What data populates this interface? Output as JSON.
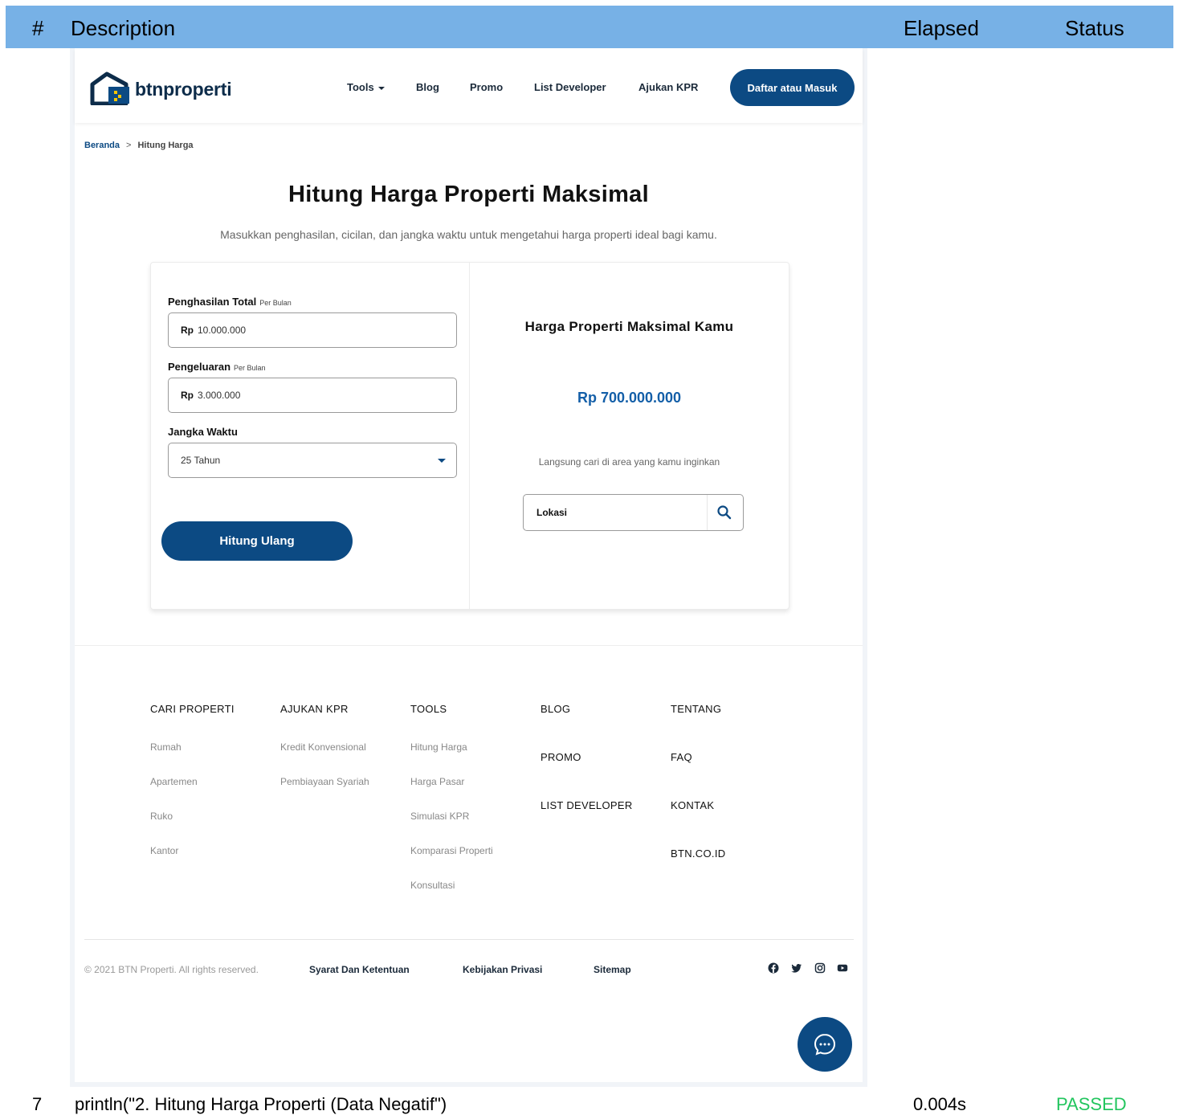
{
  "report": {
    "col_num": "#",
    "col_description": "Description",
    "col_elapsed": "Elapsed",
    "col_status": "Status",
    "row": {
      "num": "7",
      "description": "println(\"2. Hitung Harga Properti (Data Negatif\")",
      "elapsed": "0.004s",
      "status": "PASSED",
      "status_color": "#22c55e"
    }
  },
  "navbar": {
    "brand": "btnproperti",
    "items": [
      "Tools",
      "Blog",
      "Promo",
      "List Developer",
      "Ajukan KPR"
    ],
    "login_label": "Daftar atau Masuk",
    "accent": "#0c4a83"
  },
  "breadcrumb": {
    "home": "Beranda",
    "separator": ">",
    "current": "Hitung Harga"
  },
  "main": {
    "title": "Hitung Harga Properti Maksimal",
    "subtitle": "Masukkan penghasilan, cicilan, dan jangka waktu untuk mengetahui harga properti ideal bagi kamu."
  },
  "form": {
    "income_label": "Penghasilan Total",
    "income_unit": "Per Bulan",
    "income_prefix": "Rp",
    "income_value": "10.000.000",
    "expense_label": "Pengeluaran",
    "expense_unit": "Per Bulan",
    "expense_prefix": "Rp",
    "expense_value": "3.000.000",
    "term_label": "Jangka Waktu",
    "term_value": "25 Tahun",
    "submit_label": "Hitung Ulang"
  },
  "result": {
    "title": "Harga Properti Maksimal Kamu",
    "value": "Rp 700.000.000",
    "hint": "Langsung cari di area yang kamu inginkan",
    "location_placeholder": "Lokasi",
    "value_color": "#145fa8"
  },
  "footer": {
    "cari_properti": {
      "head": "CARI PROPERTI",
      "links": [
        "Rumah",
        "Apartemen",
        "Ruko",
        "Kantor"
      ]
    },
    "ajukan_kpr": {
      "head": "AJUKAN KPR",
      "links": [
        "Kredit Konvensional",
        "Pembiayaan Syariah"
      ]
    },
    "tools": {
      "head": "TOOLS",
      "links": [
        "Hitung Harga",
        "Harga Pasar",
        "Simulasi KPR",
        "Komparasi Properti",
        "Konsultasi"
      ]
    },
    "col4": [
      "BLOG",
      "PROMO",
      "LIST DEVELOPER"
    ],
    "col5": [
      "TENTANG",
      "FAQ",
      "KONTAK",
      "BTN.CO.ID"
    ],
    "copyright": "© 2021 BTN Properti. All rights reserved.",
    "legal": [
      "Syarat Dan Ketentuan",
      "Kebijakan Privasi",
      "Sitemap"
    ],
    "social_icons": [
      "facebook-icon",
      "twitter-icon",
      "instagram-icon",
      "youtube-icon"
    ]
  }
}
